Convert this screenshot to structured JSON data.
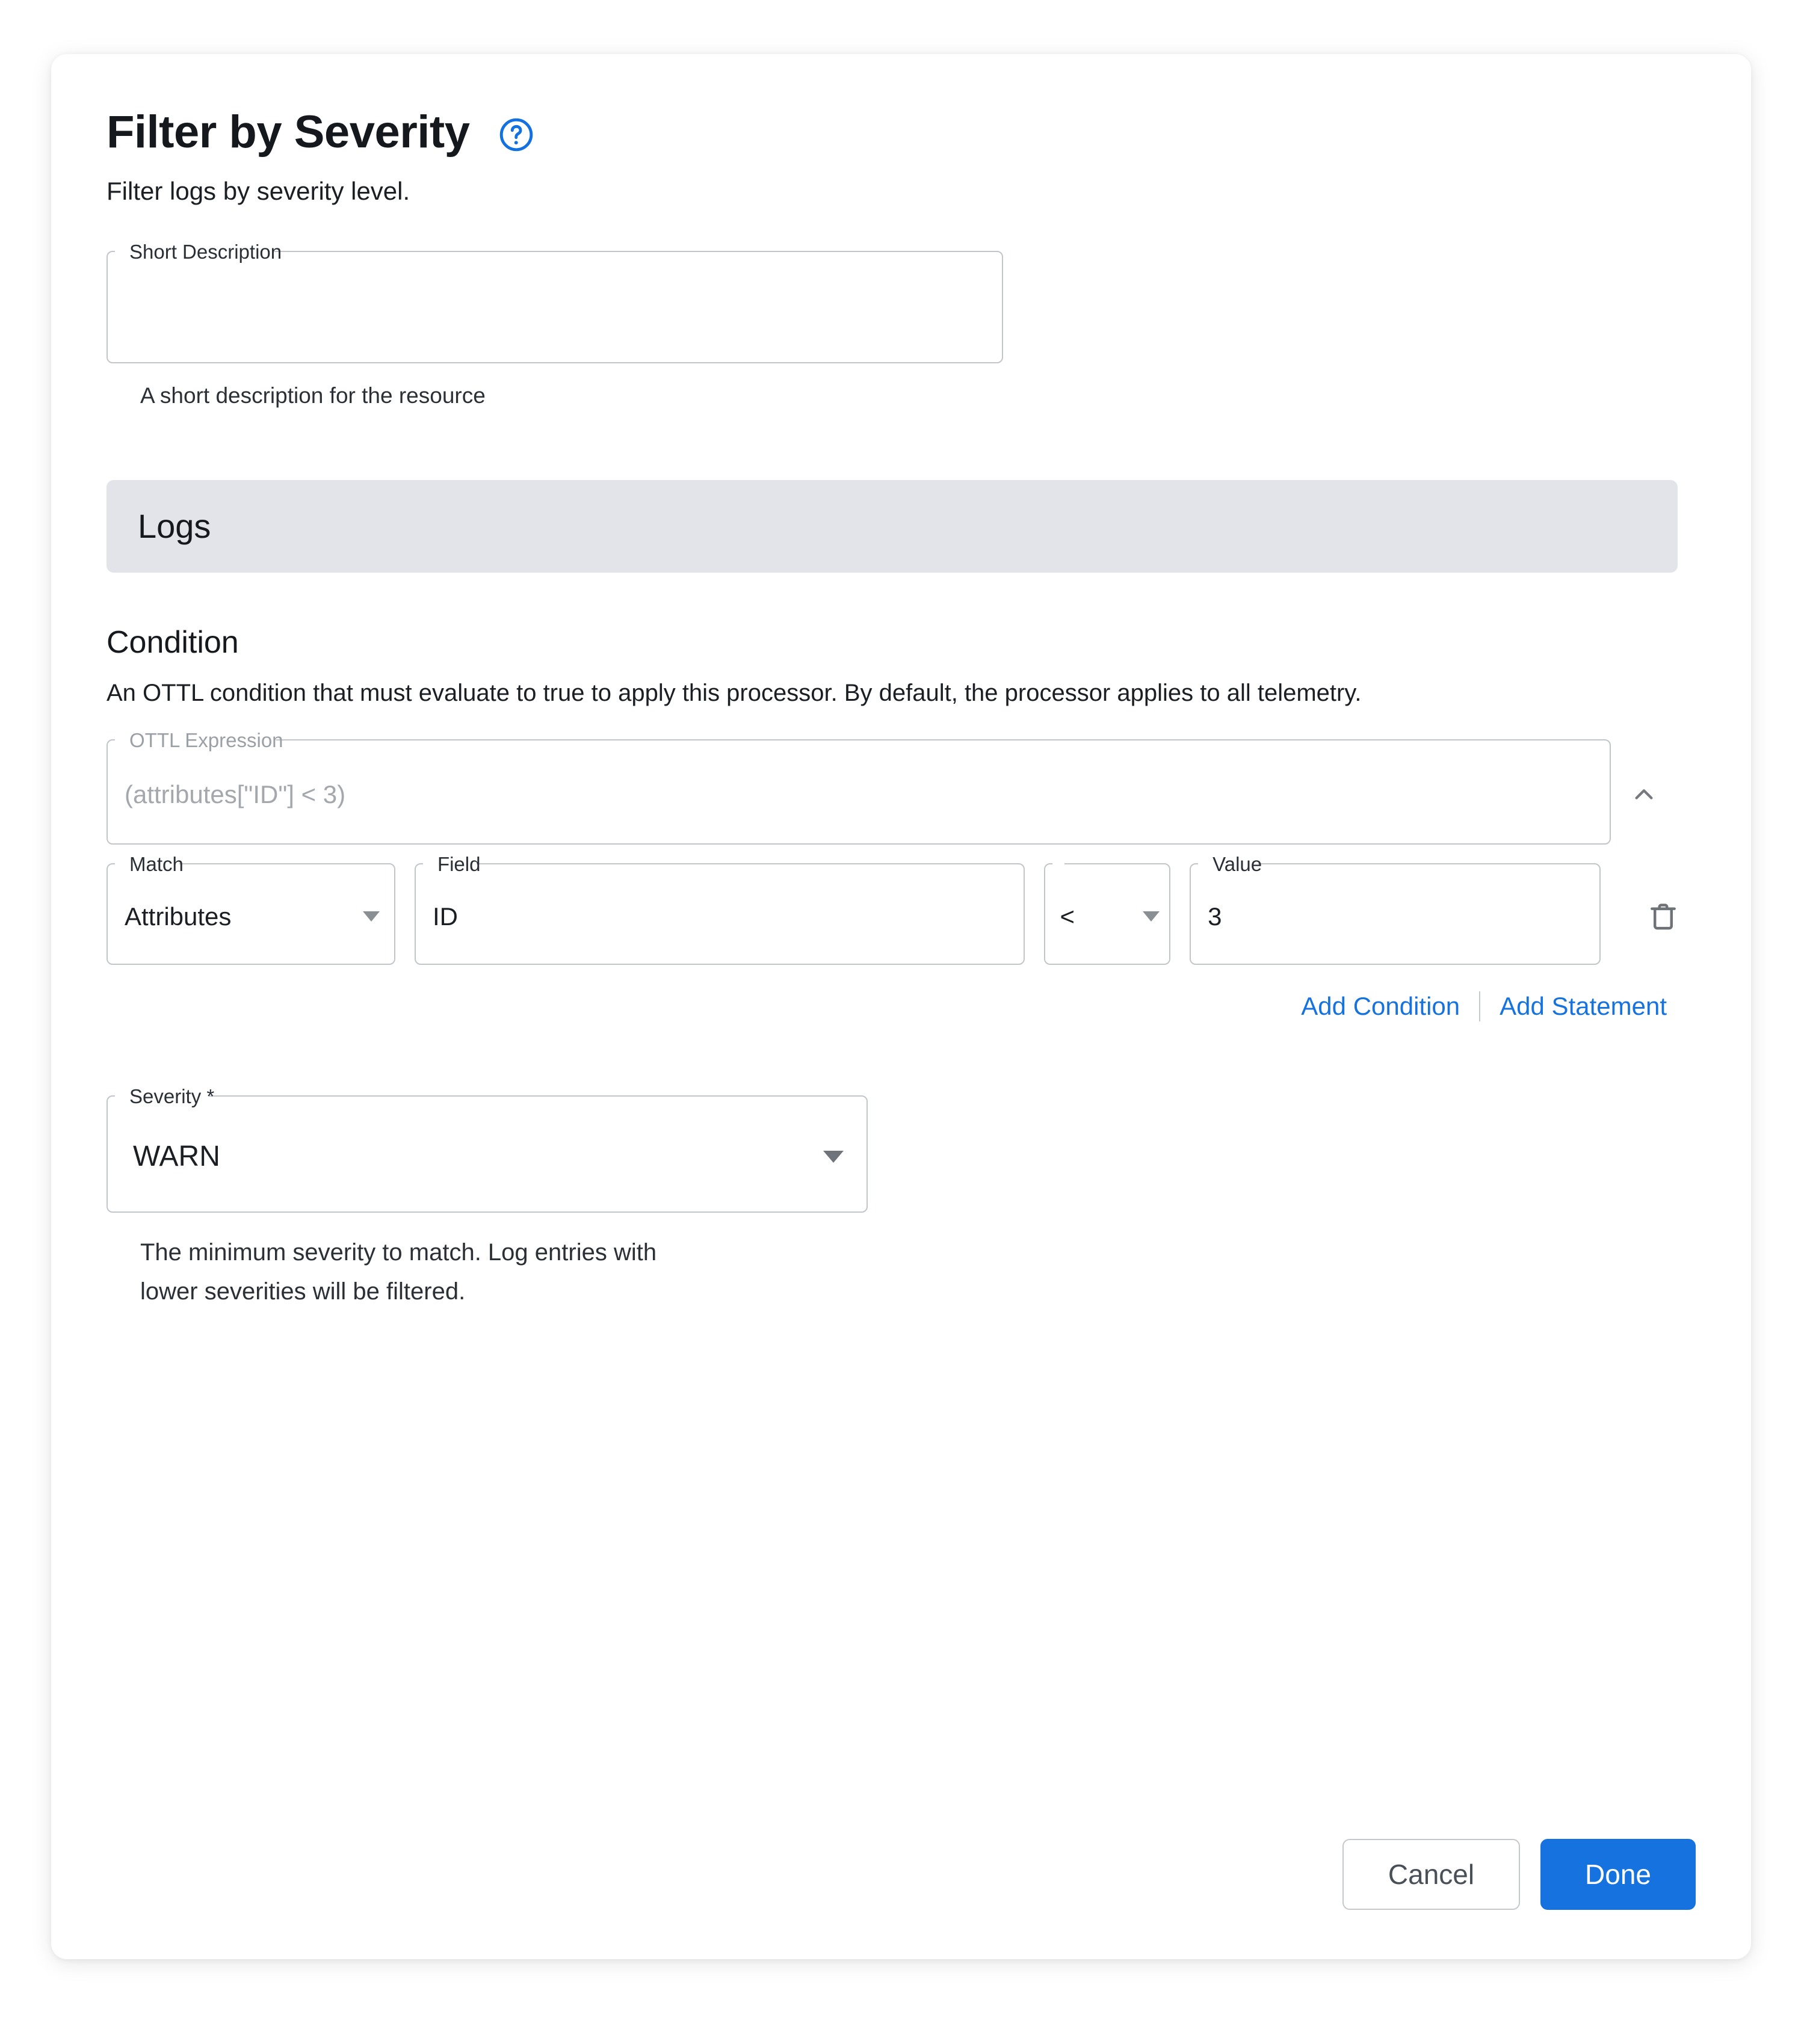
{
  "dialog": {
    "title": "Filter by Severity",
    "subtitle": "Filter logs by severity level.",
    "help_icon": "help-circle-icon"
  },
  "short_description": {
    "label": "Short Description",
    "value": "",
    "placeholder": "",
    "helper": "A short description for the resource"
  },
  "signal_banner": {
    "label": "Logs"
  },
  "condition": {
    "title": "Condition",
    "description": "An OTTL condition that must evaluate to true to apply this processor. By default, the processor applies to all telemetry.",
    "ottl": {
      "label": "OTTL Expression",
      "value": "(attributes[\"ID\"] < 3)"
    },
    "collapse_icon": "chevron-up-icon",
    "row": {
      "match": {
        "label": "Match",
        "value": "Attributes"
      },
      "field": {
        "label": "Field",
        "value": "ID"
      },
      "operator": {
        "label": "",
        "value": "<"
      },
      "value": {
        "label": "Value",
        "value": "3"
      },
      "delete_icon": "trash-icon"
    },
    "add_condition_label": "Add Condition",
    "add_statement_label": "Add Statement"
  },
  "severity": {
    "label": "Severity *",
    "value": "WARN",
    "helper_line1": "The minimum severity to match. Log entries with",
    "helper_line2": "lower severities will be filtered."
  },
  "footer": {
    "cancel_label": "Cancel",
    "done_label": "Done"
  },
  "colors": {
    "accent": "#1572DE",
    "banner": "#E2E4E9",
    "border": "#C2C5C9",
    "text": "#15181D"
  }
}
